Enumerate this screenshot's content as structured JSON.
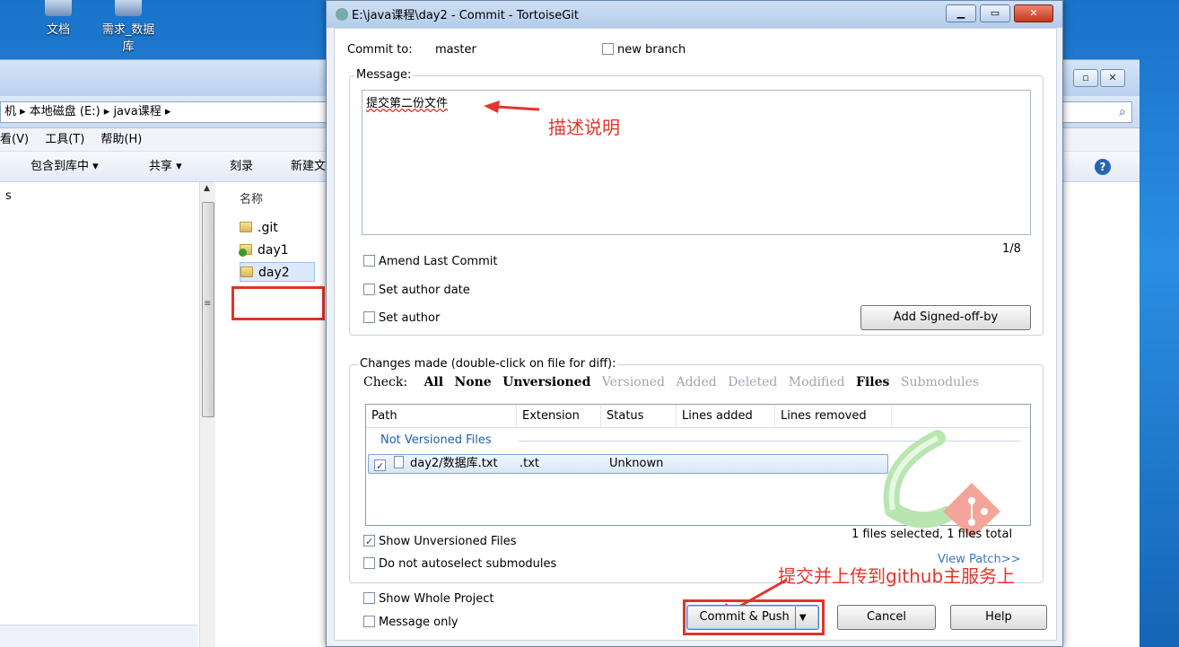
{
  "desktop": {
    "icons": [
      {
        "label": "文档"
      },
      {
        "label": "需求_数据库"
      }
    ]
  },
  "explorer": {
    "breadcrumb": "机 ▸ 本地磁盘 (E:) ▸ java课程 ▸",
    "menu": [
      "看(V)",
      "工具(T)",
      "帮助(H)"
    ],
    "toolbar": [
      "包含到库中 ▾",
      "共享 ▾",
      "刻录",
      "新建文"
    ],
    "nav_item": "s",
    "column_name": "名称",
    "files": [
      {
        "name": ".git",
        "type": "folder"
      },
      {
        "name": "day1",
        "type": "folder-ok"
      },
      {
        "name": "day2",
        "type": "folder",
        "selected": true
      }
    ]
  },
  "dialog": {
    "title": "E:\\java课程\\day2 - Commit - TortoiseGit",
    "commit_to_label": "Commit to:",
    "branch": "master",
    "new_branch_label": "new branch",
    "message_label": "Message:",
    "message_text": "提交第二份文件",
    "annotation_message": "描述说明",
    "line_counter": "1/8",
    "amend_label": "Amend Last Commit",
    "set_author_date_label": "Set author date",
    "set_author_label": "Set author",
    "signed_off_button": "Add Signed-off-by",
    "changes_label": "Changes made (double-click on file for diff):",
    "check_label": "Check:",
    "filters": [
      {
        "label": "All",
        "active": true
      },
      {
        "label": "None",
        "active": true
      },
      {
        "label": "Unversioned",
        "active": true
      },
      {
        "label": "Versioned",
        "active": false
      },
      {
        "label": "Added",
        "active": false
      },
      {
        "label": "Deleted",
        "active": false
      },
      {
        "label": "Modified",
        "active": false
      },
      {
        "label": "Files",
        "active": true
      },
      {
        "label": "Submodules",
        "active": false
      }
    ],
    "columns": [
      "Path",
      "Extension",
      "Status",
      "Lines added",
      "Lines removed"
    ],
    "group_header": "Not Versioned Files",
    "rows": [
      {
        "checked": true,
        "path": "day2/数据库.txt",
        "extension": ".txt",
        "status": "Unknown",
        "lines_added": "",
        "lines_removed": ""
      }
    ],
    "selection_summary": "1 files selected, 1 files total",
    "show_unversioned_label": "Show Unversioned Files",
    "no_autoselect_label": "Do not autoselect submodules",
    "view_patch_link": "View Patch>>",
    "annotation_push": "提交并上传到github主服务上",
    "show_whole_project_label": "Show Whole Project",
    "message_only_label": "Message only",
    "commit_push_button": "Commit & Push",
    "cancel_button": "Cancel",
    "help_button": "Help"
  },
  "colors": {
    "annotation_red": "#e3352b",
    "link_blue": "#3a76c8"
  }
}
